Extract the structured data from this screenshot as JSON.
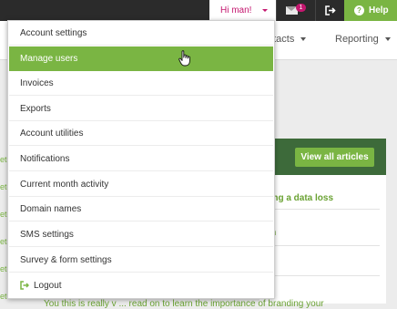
{
  "topbar": {
    "user_greeting": "Hi man!",
    "mail_badge": "1",
    "help_label": "Help"
  },
  "nav": {
    "contacts_label": "ntacts",
    "reporting_label": "Reporting"
  },
  "menu": {
    "items": [
      {
        "label": "Account settings"
      },
      {
        "label": "Manage users",
        "active": true
      },
      {
        "label": "Invoices"
      },
      {
        "label": "Exports"
      },
      {
        "label": "Account utilities"
      },
      {
        "label": "Notifications"
      },
      {
        "label": "Current month activity"
      },
      {
        "label": "Domain names"
      },
      {
        "label": "SMS settings"
      },
      {
        "label": "Survey & form settings"
      },
      {
        "label": "Logout"
      }
    ]
  },
  "left_list": {
    "rows": [
      "ete",
      "ete",
      "ete",
      "ete",
      "ete",
      "ete"
    ]
  },
  "articles": {
    "view_all_label": "View all articles",
    "items": [
      "cing a data loss",
      "on"
    ]
  },
  "bottom_text": "You this is really v ... read on to learn the importance of branding your",
  "colors": {
    "accent_green": "#7ab543",
    "brand_pink": "#c4176f",
    "topbar_bg": "#2b2b2b",
    "panel_dark_green": "#3d6a3a"
  },
  "icons": {
    "mail": "envelope-icon",
    "logout": "logout-icon",
    "help": "question-circle-icon",
    "cursor": "hand-pointer-icon"
  }
}
